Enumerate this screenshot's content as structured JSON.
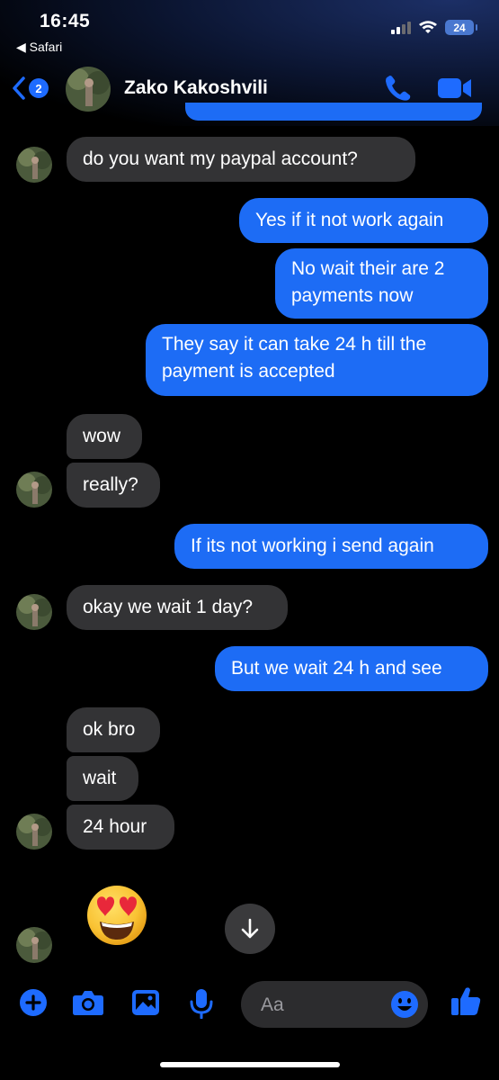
{
  "status_bar": {
    "time": "16:45",
    "back_app": "◀ Safari",
    "battery": "24"
  },
  "header": {
    "back_badge": "2",
    "contact_name": "Zako Kakoshvili"
  },
  "messages": [
    {
      "from": "them",
      "text": "do you want my paypal account?"
    },
    {
      "from": "me",
      "text": "Yes if it not work again"
    },
    {
      "from": "me",
      "text": "No wait their are 2 payments now"
    },
    {
      "from": "me",
      "text": "They say it can take 24 h till the payment is accepted"
    },
    {
      "from": "them",
      "text": "wow"
    },
    {
      "from": "them",
      "text": "really?"
    },
    {
      "from": "me",
      "text": "If its not working i send again"
    },
    {
      "from": "them",
      "text": "okay we wait 1 day?"
    },
    {
      "from": "me",
      "text": "But we wait 24 h and see"
    },
    {
      "from": "them",
      "text": "ok bro"
    },
    {
      "from": "them",
      "text": "wait"
    },
    {
      "from": "them",
      "text": "24 hour"
    },
    {
      "from": "them",
      "emoji": "😍"
    }
  ],
  "composer": {
    "placeholder": "Aa"
  },
  "icons": [
    "back-chevron-icon",
    "phone-icon",
    "video-camera-icon",
    "plus-icon",
    "camera-icon",
    "gallery-icon",
    "microphone-icon",
    "emoji-icon",
    "thumbs-up-icon",
    "arrow-down-icon"
  ],
  "colors": {
    "accent": "#1d6cf5",
    "incoming_bubble": "#333335",
    "background": "#000000"
  }
}
